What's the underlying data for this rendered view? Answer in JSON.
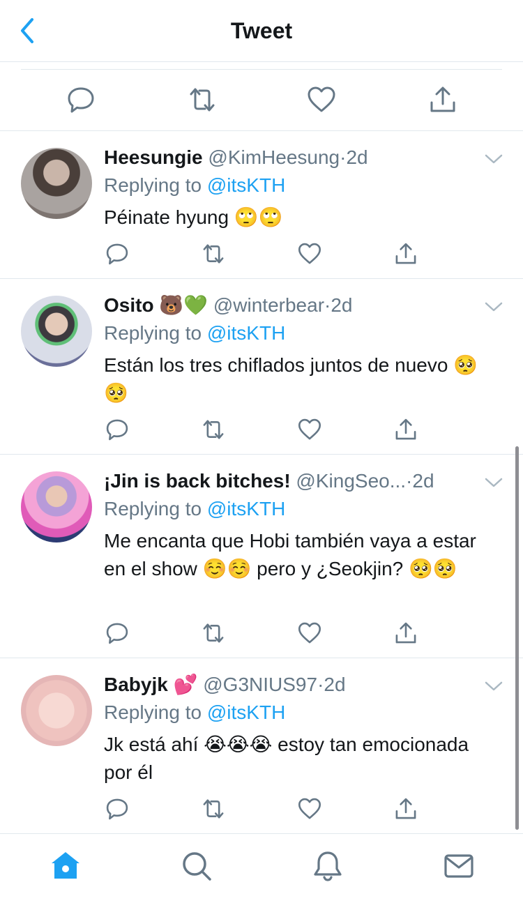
{
  "header": {
    "title": "Tweet"
  },
  "replies": [
    {
      "name": "Heesungie",
      "handle": "@KimHeesung",
      "dot": "·",
      "time": "2d",
      "replying_prefix": "Replying to",
      "replying_to": "@itsKTH",
      "text": "Péinate hyung 🙄🙄"
    },
    {
      "name": "Osito 🐻💚",
      "handle": "@winterbear",
      "dot": "·",
      "time": "2d",
      "replying_prefix": "Replying to",
      "replying_to": "@itsKTH",
      "text": "Están los tres chiflados juntos de nuevo 🥺🥺"
    },
    {
      "name": "¡Jin is back bitches!",
      "handle": "@KingSeo...",
      "dot": "·",
      "time": "2d",
      "replying_prefix": "Replying to",
      "replying_to": "@itsKTH",
      "text": "Me encanta que Hobi también vaya a estar en el show ☺️☺️ pero y ¿Seokjin? 🥺🥺"
    },
    {
      "name": "Babyjk 💕",
      "handle": "@G3NIUS97",
      "dot": "·",
      "time": "2d",
      "replying_prefix": "Replying to",
      "replying_to": "@itsKTH",
      "text": "Jk está ahí 😭😭😭 estoy tan emocionada por él"
    }
  ],
  "icons": {
    "back": "chevron-left-icon",
    "reply": "reply-icon",
    "retweet": "retweet-icon",
    "like": "heart-icon",
    "share": "share-icon",
    "caret": "chevron-down-icon",
    "home": "home-icon",
    "search": "search-icon",
    "notifications": "bell-icon",
    "messages": "mail-icon"
  },
  "colors": {
    "accent": "#1da1f2",
    "icon_gray": "#657786",
    "text": "#14171a",
    "divider": "#e1e8ed"
  }
}
